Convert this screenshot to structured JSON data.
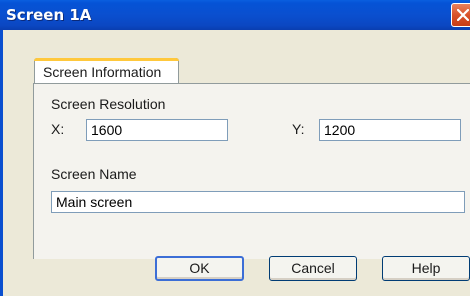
{
  "window": {
    "title": "Screen 1A"
  },
  "tabs": [
    {
      "label": "Screen Information"
    }
  ],
  "resolution": {
    "heading": "Screen Resolution",
    "x_label": "X:",
    "x_value": "1600",
    "y_label": "Y:",
    "y_value": "1200"
  },
  "screen_name": {
    "label": "Screen Name",
    "value": "Main screen"
  },
  "buttons": {
    "ok": "OK",
    "cancel": "Cancel",
    "help": "Help"
  },
  "icons": {
    "close": "close-icon"
  },
  "colors": {
    "titlebar": "#0a4fcf",
    "dialog_bg": "#ece9d8",
    "close": "#d9522a"
  }
}
